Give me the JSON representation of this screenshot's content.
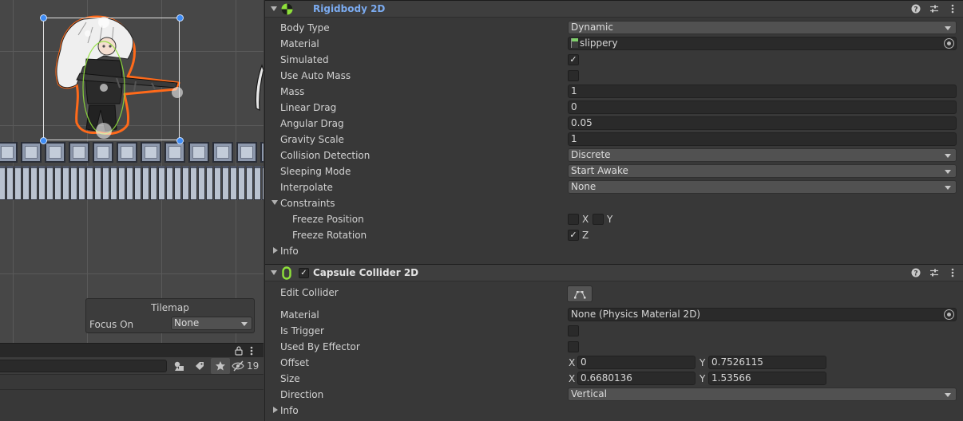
{
  "scene": {
    "overlay": {
      "title": "Tilemap",
      "focus_label": "Focus On",
      "focus_value": "None"
    }
  },
  "project": {
    "hidden_count": "19"
  },
  "rigidbody": {
    "title": "Rigidbody 2D",
    "body_type_label": "Body Type",
    "body_type_value": "Dynamic",
    "material_label": "Material",
    "material_value": "slippery",
    "simulated_label": "Simulated",
    "simulated_checked": true,
    "use_auto_mass_label": "Use Auto Mass",
    "use_auto_mass_checked": false,
    "mass_label": "Mass",
    "mass_value": "1",
    "linear_drag_label": "Linear Drag",
    "linear_drag_value": "0",
    "angular_drag_label": "Angular Drag",
    "angular_drag_value": "0.05",
    "gravity_scale_label": "Gravity Scale",
    "gravity_scale_value": "1",
    "collision_detection_label": "Collision Detection",
    "collision_detection_value": "Discrete",
    "sleeping_mode_label": "Sleeping Mode",
    "sleeping_mode_value": "Start Awake",
    "interpolate_label": "Interpolate",
    "interpolate_value": "None",
    "constraints_label": "Constraints",
    "freeze_position_label": "Freeze Position",
    "freeze_position_x_label": "X",
    "freeze_position_y_label": "Y",
    "freeze_rotation_label": "Freeze Rotation",
    "freeze_rotation_z_label": "Z",
    "info_label": "Info"
  },
  "capsule": {
    "title": "Capsule Collider 2D",
    "edit_collider_label": "Edit Collider",
    "material_label": "Material",
    "material_value": "None (Physics Material 2D)",
    "is_trigger_label": "Is Trigger",
    "used_by_effector_label": "Used By Effector",
    "offset_label": "Offset",
    "offset_x_label": "X",
    "offset_x_value": "0",
    "offset_y_label": "Y",
    "offset_y_value": "0.7526115",
    "size_label": "Size",
    "size_x_label": "X",
    "size_x_value": "0.6680136",
    "size_y_label": "Y",
    "size_y_value": "1.53566",
    "direction_label": "Direction",
    "direction_value": "Vertical",
    "info_label": "Info"
  },
  "icons": {
    "rigidbody": "rigidbody-2d-icon",
    "capsule": "capsule-collider-2d-icon",
    "help": "help-icon",
    "presets": "presets-icon",
    "menu": "kebab-menu-icon"
  },
  "colors": {
    "panel": "#383838",
    "scene": "#474747",
    "selection_outline": "#ff6a1a",
    "handle": "#3e8cf5",
    "collider_green": "#8ee03a",
    "prefab_title": "#7babf0"
  }
}
